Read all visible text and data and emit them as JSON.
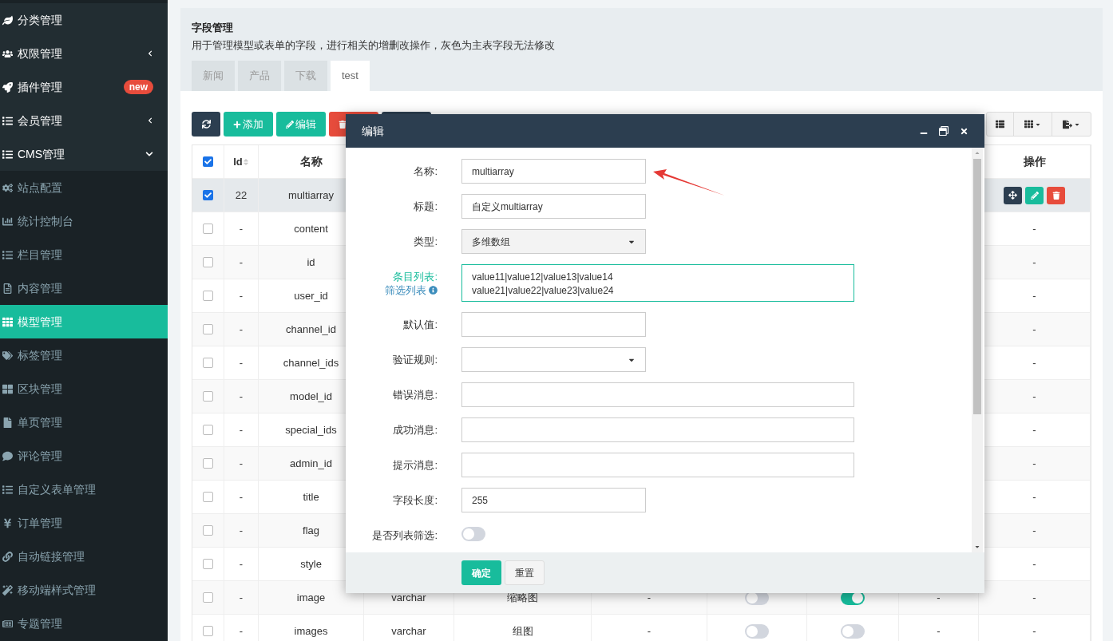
{
  "sidebar": {
    "items": [
      {
        "label": "分类管理",
        "kind": "group",
        "selected": false
      },
      {
        "label": "权限管理",
        "kind": "group",
        "selected": false,
        "expanded": false
      },
      {
        "label": "插件管理",
        "kind": "group",
        "selected": false,
        "badge": "new"
      },
      {
        "label": "会员管理",
        "kind": "group",
        "selected": false,
        "expanded": false
      },
      {
        "label": "CMS管理",
        "kind": "group",
        "selected": false,
        "expanded": true
      },
      {
        "label": "站点配置",
        "kind": "sub",
        "selected": false
      },
      {
        "label": "统计控制台",
        "kind": "sub",
        "selected": false
      },
      {
        "label": "栏目管理",
        "kind": "sub",
        "selected": false
      },
      {
        "label": "内容管理",
        "kind": "sub",
        "selected": false
      },
      {
        "label": "模型管理",
        "kind": "sub",
        "selected": true
      },
      {
        "label": "标签管理",
        "kind": "sub",
        "selected": false
      },
      {
        "label": "区块管理",
        "kind": "sub",
        "selected": false
      },
      {
        "label": "单页管理",
        "kind": "sub",
        "selected": false
      },
      {
        "label": "评论管理",
        "kind": "sub",
        "selected": false
      },
      {
        "label": "自定义表单管理",
        "kind": "sub",
        "selected": false
      },
      {
        "label": "订单管理",
        "kind": "sub",
        "selected": false
      },
      {
        "label": "自动链接管理",
        "kind": "sub",
        "selected": false
      },
      {
        "label": "移动端样式管理",
        "kind": "sub",
        "selected": false
      },
      {
        "label": "专题管理",
        "kind": "sub",
        "selected": false
      }
    ]
  },
  "panel": {
    "title": "字段管理",
    "description": "用于管理模型或表单的字段，进行相关的增删改操作，灰色为主表字段无法修改",
    "tabs": [
      {
        "label": "新闻",
        "selected": false
      },
      {
        "label": "产品",
        "selected": false
      },
      {
        "label": "下载",
        "selected": false
      },
      {
        "label": "test",
        "selected": true
      }
    ]
  },
  "toolbar": {
    "add": "添加",
    "edit": "编辑"
  },
  "table": {
    "header": {
      "select_all_checked": true,
      "id": "Id",
      "name": "名称",
      "operation": "操作"
    },
    "rows": [
      {
        "checked": true,
        "id": "22",
        "name": "multiarray",
        "actions": true
      },
      {
        "checked": false,
        "id": "-",
        "name": "content",
        "operation": "-"
      },
      {
        "checked": false,
        "id": "-",
        "name": "id",
        "operation": "-"
      },
      {
        "checked": false,
        "id": "-",
        "name": "user_id",
        "operation": "-"
      },
      {
        "checked": false,
        "id": "-",
        "name": "channel_id",
        "operation": "-"
      },
      {
        "checked": false,
        "id": "-",
        "name": "channel_ids",
        "operation": "-"
      },
      {
        "checked": false,
        "id": "-",
        "name": "model_id",
        "operation": "-"
      },
      {
        "checked": false,
        "id": "-",
        "name": "special_ids",
        "operation": "-"
      },
      {
        "checked": false,
        "id": "-",
        "name": "admin_id",
        "operation": "-"
      },
      {
        "checked": false,
        "id": "-",
        "name": "title",
        "operation": "-"
      },
      {
        "checked": false,
        "id": "-",
        "name": "flag",
        "operation": "-"
      },
      {
        "checked": false,
        "id": "-",
        "name": "style",
        "operation": "-"
      },
      {
        "checked": false,
        "id": "-",
        "name": "image",
        "type": "varchar",
        "title": "缩略图",
        "column_6": "-",
        "toggle_1": false,
        "toggle_2": true,
        "column_9": "-",
        "operation": "-"
      },
      {
        "checked": false,
        "id": "-",
        "name": "images",
        "type": "varchar",
        "title": "组图",
        "column_6": "-",
        "toggle_1": false,
        "toggle_2": false,
        "column_9": "-",
        "operation": "-"
      }
    ]
  },
  "dialog": {
    "title": "编辑",
    "fields": [
      {
        "kind": "text",
        "label": "名称:",
        "value": "multiarray"
      },
      {
        "kind": "text",
        "label": "标题:",
        "value": "自定义multiarray"
      },
      {
        "kind": "select",
        "label": "类型:",
        "value": "多维数组"
      },
      {
        "kind": "textarea",
        "labels": [
          "条目列表:",
          "筛选列表"
        ],
        "value": "value11|value12|value13|value14\nvalue21|value22|value23|value24"
      },
      {
        "kind": "text",
        "label": "默认值:"
      },
      {
        "kind": "select",
        "label": "验证规则:"
      },
      {
        "kind": "long-text",
        "label": "错误消息:"
      },
      {
        "kind": "long-text",
        "label": "成功消息:"
      },
      {
        "kind": "long-text",
        "label": "提示消息:"
      },
      {
        "kind": "text",
        "label": "字段长度:",
        "value": "255"
      },
      {
        "kind": "toggle",
        "label": "是否列表筛选:",
        "on": false
      }
    ],
    "buttons": [
      "确定",
      "重置"
    ]
  }
}
